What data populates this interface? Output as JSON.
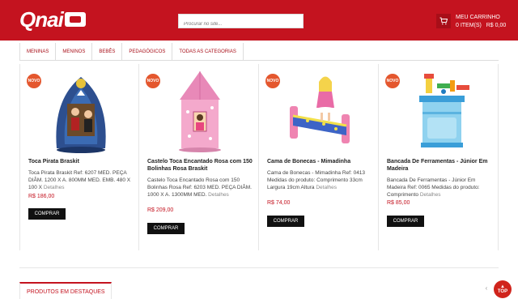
{
  "header": {
    "logo_text": "Qnai",
    "search_placeholder": "Procurar no site...",
    "cart": {
      "title": "MEU CARRINHO",
      "items": "0 ITEM(S)",
      "total": "R$ 0,00"
    }
  },
  "nav": {
    "items": [
      {
        "label": "MENINAS"
      },
      {
        "label": "MENINOS"
      },
      {
        "label": "BEBÊS"
      },
      {
        "label": "PEDAGÓGICOS"
      },
      {
        "label": "TODAS AS CATEGORIAS"
      }
    ]
  },
  "products": [
    {
      "badge": "NOVO",
      "name": "Toca Pirata Braskit",
      "description": "Toca Pirata Braskit Ref: 6207 MED. PEÇA DIÂM. 1200 X A. 800MM MED. EMB. 480 X 100 X",
      "more": "Detalhes",
      "price": "R$ 186,00",
      "buy_label": "COMPRAR"
    },
    {
      "badge": "NOVO",
      "name": "Castelo Toca Encantado Rosa com 150 Bolinhas Rosa Braskit",
      "description": "Castelo Toca Encantado Rosa com 150 Bolinhas Rosa Ref: 6203 MED. PEÇA DIÂM. 1000 X A. 1300MM MED.",
      "more": "Detalhes",
      "price": "R$ 209,00",
      "buy_label": "COMPRAR"
    },
    {
      "badge": "NOVO",
      "name": "Cama de Bonecas - Mimadinha",
      "description": "Cama de Bonecas - Mimadinha Ref: 0413 Medidas do produto: Comprimento 33cm Largura 19cm Altura",
      "more": "Detalhes",
      "price": "R$ 74,00",
      "buy_label": "COMPRAR"
    },
    {
      "badge": "NOVO",
      "name": "Bancada De Ferramentas - Júnior Em Madeira",
      "description": "Bancada De Ferramentas - Júnior Em Madeira Ref: 0065 Medidas do produto: Comprimento",
      "more": "Detalhes",
      "price": "R$ 85,00",
      "buy_label": "COMPRAR"
    }
  ],
  "featured": {
    "label": "PRODUTOS EM DESTAQUES"
  },
  "controls": {
    "prev_arrow": "‹",
    "top_label": "TOP"
  },
  "colors": {
    "brand_red": "#c4131f",
    "badge_orange": "#e4572e"
  }
}
